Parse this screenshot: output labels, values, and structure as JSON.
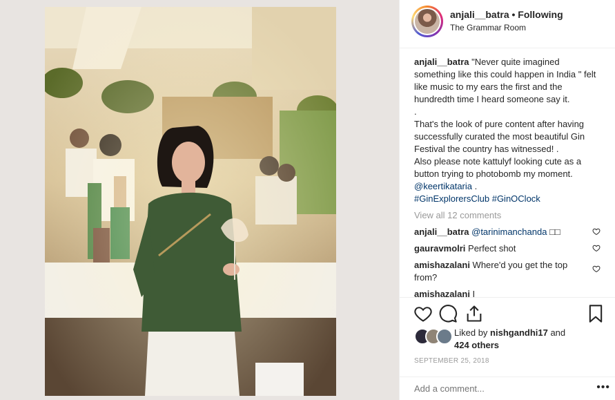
{
  "post": {
    "username": "anjali__batra",
    "separator": " • ",
    "follow_state": "Following",
    "location": "The Grammar Room",
    "caption": {
      "username": "anjali__batra",
      "text": " \"Never quite imagined something like this could happen in India \" felt like music to my ears the first and the hundredth time I heard someone say it.\n.\nThat's the look of pure content after having successfully curated the most beautiful Gin Festival the country has witnessed! .\nAlso please note kattulyf looking cute as a button trying to photobomb my moment. ",
      "mention": "@keertikataria",
      "mention_suffix": " .",
      "hashtags": "#GinExplorersClub #GinOClock"
    },
    "view_all": "View all 12 comments",
    "comments": [
      {
        "user": "anjali__batra",
        "text": " ",
        "mention": "@tarinimanchanda",
        "extra": " □□"
      },
      {
        "user": "gauravmolri",
        "text": " Perfect shot",
        "mention": "",
        "extra": ""
      },
      {
        "user": "amishazalani",
        "text": " Where'd you get the top from?",
        "mention": "",
        "extra": ""
      },
      {
        "user": "amishazalani",
        "text": " I ",
        "mention": "",
        "extra": ""
      }
    ],
    "likes": {
      "prefix": "Liked by ",
      "user": "nishgandhi17",
      "suffix": " and",
      "others": "424 others"
    },
    "date": "SEPTEMBER 25, 2018",
    "add_comment_placeholder": "Add a comment...",
    "more_label": "•••"
  },
  "icons": {
    "like": "heart-icon",
    "comment": "comment-icon",
    "share": "share-icon",
    "save": "bookmark-icon"
  }
}
